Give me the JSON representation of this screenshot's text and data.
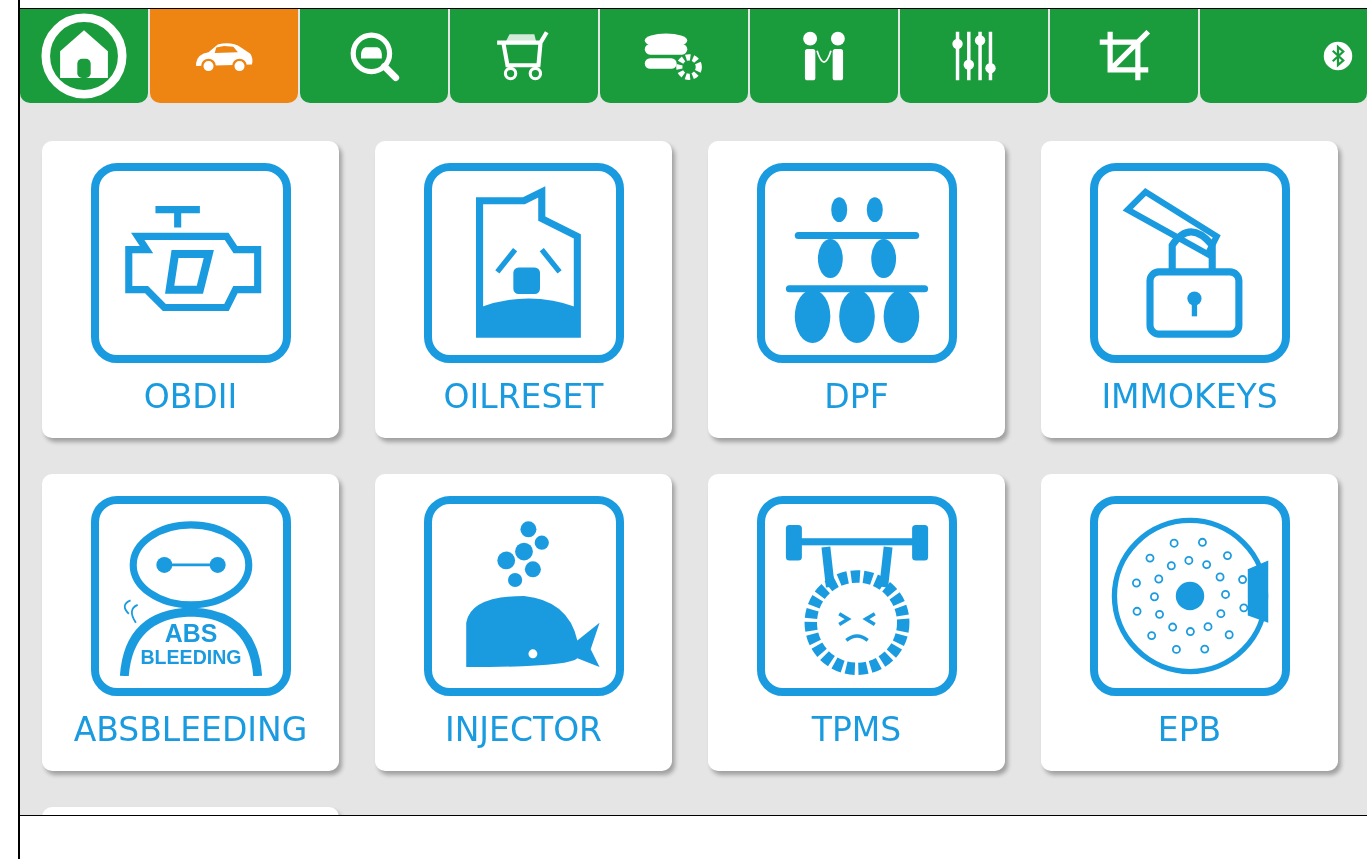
{
  "tabs": [
    {
      "kind": "home",
      "selected": false
    },
    {
      "kind": "car",
      "selected": true
    },
    {
      "kind": "car-search",
      "selected": false
    },
    {
      "kind": "cart",
      "selected": false
    },
    {
      "kind": "database-gear",
      "selected": false
    },
    {
      "kind": "people",
      "selected": false
    },
    {
      "kind": "sliders",
      "selected": false
    },
    {
      "kind": "crop",
      "selected": false
    },
    {
      "kind": "bluetooth",
      "selected": false
    }
  ],
  "cards": [
    {
      "kind": "engine",
      "label": "OBDII"
    },
    {
      "kind": "oil-can",
      "label": "OILRESET"
    },
    {
      "kind": "filter",
      "label": "DPF"
    },
    {
      "kind": "lock",
      "label": "IMMOKEYS"
    },
    {
      "kind": "robot",
      "label": "ABSBLEEDING",
      "icon_text": [
        "ABS",
        "BLEEDING"
      ]
    },
    {
      "kind": "whale",
      "label": "INJECTOR"
    },
    {
      "kind": "tire",
      "label": "TPMS"
    },
    {
      "kind": "brake-disc",
      "label": "EPB"
    }
  ],
  "more_below": true
}
